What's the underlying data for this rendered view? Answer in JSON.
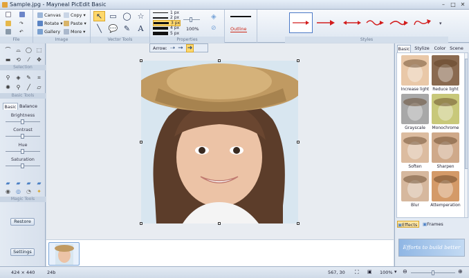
{
  "window": {
    "title": "Sample.jpg - Mayneal PicEdit Basic",
    "controls": [
      "–",
      "□",
      "✕"
    ]
  },
  "ribbon": {
    "file_label": "File",
    "image": {
      "label": "Image",
      "canvas": "Canvas",
      "rotate": "Rotate",
      "gallery": "Gallery",
      "copy": "Copy",
      "paste": "Paste",
      "more": "More"
    },
    "vector_label": "Vector Tools",
    "properties": {
      "label": "Properties",
      "strokes": [
        "1 px",
        "2 px",
        "3 px",
        "4 px",
        "5 px"
      ],
      "zoom": "100%",
      "outline": "Outline"
    },
    "styles_label": "Styles"
  },
  "arrow_bar": {
    "label": "Arrow:"
  },
  "left_panel": {
    "selection_label": "Selection",
    "basic_tools_label": "Basic Tools",
    "tabs": [
      "Basic",
      "Balance"
    ],
    "sliders": [
      {
        "label": "Brightness",
        "value": 0.5
      },
      {
        "label": "Contrast",
        "value": 0.5
      },
      {
        "label": "Hue",
        "value": 0.5
      },
      {
        "label": "Saturation",
        "value": 0.5
      }
    ],
    "magic_tools_label": "Magic Tools",
    "restore": "Restore",
    "settings": "Settings"
  },
  "right_panel": {
    "tabs": [
      "Basic",
      "Stylize",
      "Color",
      "Scene"
    ],
    "effects": [
      {
        "label": "Increase light",
        "tint": "#e9c8a8"
      },
      {
        "label": "Reduce light",
        "tint": "#8a6a50"
      },
      {
        "label": "Grayscale",
        "tint": "#a8a8a8"
      },
      {
        "label": "Monochrome",
        "tint": "#c8c87a"
      },
      {
        "label": "Soften",
        "tint": "#dcbca0"
      },
      {
        "label": "Sharpen",
        "tint": "#cfa98a"
      },
      {
        "label": "Blur",
        "tint": "#d6b89e"
      },
      {
        "label": "Attemperation",
        "tint": "#d49a68"
      }
    ],
    "bottom_tabs": [
      "Effects",
      "Frames"
    ],
    "banner": "Efforts to build better"
  },
  "status": {
    "dimensions": "424 × 440",
    "bits": "24b",
    "coords": "567, 30",
    "zoom": "100%"
  },
  "colors": {
    "accent": "#ffd86b",
    "panel": "#e3eaf3",
    "ribbon": "#dde6f1",
    "arrow_red": "#d21c1c"
  }
}
